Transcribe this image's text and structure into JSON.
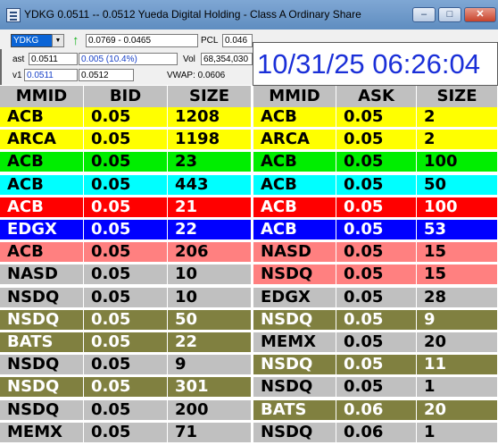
{
  "window": {
    "title": "YDKG     0.0511 -- 0.0512     Yueda Digital Holding - Class A Ordinary Share",
    "buttons": [
      "minimize",
      "maximize",
      "close"
    ]
  },
  "controls": {
    "symbol": "YDKG",
    "range": "0.0769 - 0.0465",
    "pcl_label": "PCL",
    "pcl_value": "0.046",
    "last_label": "ast",
    "last_value": "0.0511",
    "change_value": "0.005   (10.4%)",
    "vol_label": "Vol",
    "vol_value": "68,354,030",
    "v1_label": "v1",
    "v1_value": "0.0511",
    "v2_value": "0.0512",
    "vwap_label": "VWAP: 0.0606",
    "clock": "10/31/25 06:26:04"
  },
  "colors": {
    "yellow": "#ffff00",
    "green": "#00ee00",
    "cyan": "#00ffff",
    "red": "#ff0000",
    "blue": "#0000ff",
    "salmon": "#ff8080",
    "gray": "#c0c0c0",
    "olive": "#808040"
  },
  "headers": [
    "MMID",
    "BID",
    "SIZE",
    "MMID",
    "ASK",
    "SIZE"
  ],
  "bids": [
    {
      "mmid": "ACB",
      "price": "0.05",
      "size": "1208",
      "bg": "yellow",
      "fg": "#000000"
    },
    {
      "mmid": "ARCA",
      "price": "0.05",
      "size": "1198",
      "bg": "yellow",
      "fg": "#000000"
    },
    {
      "mmid": "ACB",
      "price": "0.05",
      "size": "23",
      "bg": "green",
      "fg": "#000000"
    },
    {
      "mmid": "ACB",
      "price": "0.05",
      "size": "443",
      "bg": "cyan",
      "fg": "#000000"
    },
    {
      "mmid": "ACB",
      "price": "0.05",
      "size": "21",
      "bg": "red",
      "fg": "#ffffff"
    },
    {
      "mmid": "EDGX",
      "price": "0.05",
      "size": "22",
      "bg": "blue",
      "fg": "#ffffff"
    },
    {
      "mmid": "ACB",
      "price": "0.05",
      "size": "206",
      "bg": "salmon",
      "fg": "#000000"
    },
    {
      "mmid": "NASD",
      "price": "0.05",
      "size": "10",
      "bg": "gray",
      "fg": "#000000"
    },
    {
      "mmid": "NSDQ",
      "price": "0.05",
      "size": "10",
      "bg": "gray",
      "fg": "#000000"
    },
    {
      "mmid": "NSDQ",
      "price": "0.05",
      "size": "50",
      "bg": "olive",
      "fg": "#ffffff"
    },
    {
      "mmid": "BATS",
      "price": "0.05",
      "size": "22",
      "bg": "olive",
      "fg": "#ffffff"
    },
    {
      "mmid": "NSDQ",
      "price": "0.05",
      "size": "9",
      "bg": "gray",
      "fg": "#000000"
    },
    {
      "mmid": "NSDQ",
      "price": "0.05",
      "size": "301",
      "bg": "olive",
      "fg": "#ffffff"
    },
    {
      "mmid": "NSDQ",
      "price": "0.05",
      "size": "200",
      "bg": "gray",
      "fg": "#000000"
    },
    {
      "mmid": "MEMX",
      "price": "0.05",
      "size": "71",
      "bg": "gray",
      "fg": "#000000"
    }
  ],
  "asks": [
    {
      "mmid": "ACB",
      "price": "0.05",
      "size": "2",
      "bg": "yellow",
      "fg": "#000000"
    },
    {
      "mmid": "ARCA",
      "price": "0.05",
      "size": "2",
      "bg": "yellow",
      "fg": "#000000"
    },
    {
      "mmid": "ACB",
      "price": "0.05",
      "size": "100",
      "bg": "green",
      "fg": "#000000"
    },
    {
      "mmid": "ACB",
      "price": "0.05",
      "size": "50",
      "bg": "cyan",
      "fg": "#000000"
    },
    {
      "mmid": "ACB",
      "price": "0.05",
      "size": "100",
      "bg": "red",
      "fg": "#ffffff"
    },
    {
      "mmid": "ACB",
      "price": "0.05",
      "size": "53",
      "bg": "blue",
      "fg": "#ffffff"
    },
    {
      "mmid": "NASD",
      "price": "0.05",
      "size": "15",
      "bg": "salmon",
      "fg": "#000000"
    },
    {
      "mmid": "NSDQ",
      "price": "0.05",
      "size": "15",
      "bg": "salmon",
      "fg": "#000000"
    },
    {
      "mmid": "EDGX",
      "price": "0.05",
      "size": "28",
      "bg": "gray",
      "fg": "#000000"
    },
    {
      "mmid": "NSDQ",
      "price": "0.05",
      "size": "9",
      "bg": "olive",
      "fg": "#ffffff"
    },
    {
      "mmid": "MEMX",
      "price": "0.05",
      "size": "20",
      "bg": "gray",
      "fg": "#000000"
    },
    {
      "mmid": "NSDQ",
      "price": "0.05",
      "size": "11",
      "bg": "olive",
      "fg": "#ffffff"
    },
    {
      "mmid": "NSDQ",
      "price": "0.05",
      "size": "1",
      "bg": "gray",
      "fg": "#000000"
    },
    {
      "mmid": "BATS",
      "price": "0.06",
      "size": "20",
      "bg": "olive",
      "fg": "#ffffff"
    },
    {
      "mmid": "NSDQ",
      "price": "0.06",
      "size": "1",
      "bg": "gray",
      "fg": "#000000"
    }
  ]
}
